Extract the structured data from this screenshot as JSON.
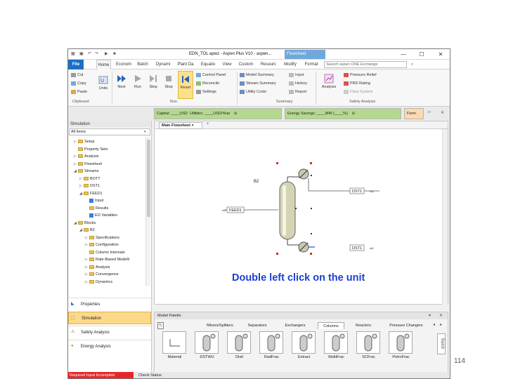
{
  "titlebar": {
    "title": "EDN_TOL apwz - Aspen Plus V10 - aspen...",
    "context_tab": "Flowsheet"
  },
  "menus": [
    "File",
    "Home",
    "Econom",
    "Batch",
    "Dynami",
    "Plant Da",
    "Equatio",
    "View",
    "Custom",
    "Resourc",
    "Modify",
    "Format"
  ],
  "search": {
    "placeholder": "Search aspen ONE Exchange"
  },
  "ribbon": {
    "clipboard": {
      "cut": "Cut",
      "copy": "Copy",
      "paste": "Paste",
      "label": "Clipboard"
    },
    "units": "Units",
    "run": {
      "next": "Next",
      "run": "Run",
      "step": "Step",
      "stop": "Stop",
      "reset": "Reset",
      "label": "Run"
    },
    "control": {
      "control_panel": "Control Panel",
      "reconcile": "Reconcile",
      "settings": "Settings"
    },
    "summary": {
      "model_summary": "Model Summary",
      "stream_summary": "Stream Summary",
      "utility_costs": "Utility Costs",
      "label": "Summary",
      "input": "Input",
      "history": "History",
      "report": "Report"
    },
    "analysis": {
      "analysis": "Analysis",
      "pressure_relief": "Pressure Relief",
      "prd_rating": "PRD Rating",
      "flare_system": "Flare System",
      "label": "Safety Analysis"
    }
  },
  "toolbar": {
    "capital": "Capital: ____USD",
    "utilities": "Utilities: ____USD/Year",
    "energy": "Energy Savings: ____MW (____%)",
    "form": "Form"
  },
  "nav": {
    "header": "Simulation",
    "filter": "All Items",
    "tree": [
      {
        "label": "Setup",
        "depth": 1,
        "arrow": "▷",
        "icon": "folder"
      },
      {
        "label": "Property Sets",
        "depth": 1,
        "arrow": "",
        "icon": "folder"
      },
      {
        "label": "Analysis",
        "depth": 1,
        "arrow": "▷",
        "icon": "folder"
      },
      {
        "label": "Flowsheet",
        "depth": 1,
        "arrow": "▷",
        "icon": "folder"
      },
      {
        "label": "Streams",
        "depth": 1,
        "arrow": "◢",
        "icon": "folder"
      },
      {
        "label": "BOTT",
        "depth": 2,
        "arrow": "▷",
        "icon": "folder"
      },
      {
        "label": "DST1",
        "depth": 2,
        "arrow": "▷",
        "icon": "folder"
      },
      {
        "label": "FEED1",
        "depth": 2,
        "arrow": "◢",
        "icon": "folder"
      },
      {
        "label": "Input",
        "depth": 3,
        "arrow": "",
        "icon": "check"
      },
      {
        "label": "Results",
        "depth": 3,
        "arrow": "",
        "icon": "folder"
      },
      {
        "label": "EO Variables",
        "depth": 3,
        "arrow": "",
        "icon": "check"
      },
      {
        "label": "Blocks",
        "depth": 1,
        "arrow": "◢",
        "icon": "folder"
      },
      {
        "label": "B2",
        "depth": 2,
        "arrow": "◢",
        "icon": "folder"
      },
      {
        "label": "Specifications",
        "depth": 3,
        "arrow": "▷",
        "icon": "folder"
      },
      {
        "label": "Configuration",
        "depth": 3,
        "arrow": "▷",
        "icon": "folder"
      },
      {
        "label": "Column Internals",
        "depth": 3,
        "arrow": "",
        "icon": "folder"
      },
      {
        "label": "Rate-Based Modelli",
        "depth": 3,
        "arrow": "▷",
        "icon": "folder"
      },
      {
        "label": "Analysis",
        "depth": 3,
        "arrow": "▷",
        "icon": "folder"
      },
      {
        "label": "Convergence",
        "depth": 3,
        "arrow": "▷",
        "icon": "folder"
      },
      {
        "label": "Dynamics",
        "depth": 3,
        "arrow": "▷",
        "icon": "folder"
      }
    ],
    "buttons": [
      "Properties",
      "Simulation",
      "Safety Analysis",
      "Energy Analysis"
    ]
  },
  "main": {
    "tab": "Main Flowsheet",
    "block_label": "B2",
    "streams": {
      "feed": "FEED1",
      "distillate": "DST1",
      "bottoms": "DST1"
    },
    "annotation": "Double left click on the unit"
  },
  "palette": {
    "header": "Model Palette",
    "categories": [
      "Mixers/Splitters",
      "Separators",
      "Exchangers",
      "Columns",
      "Reactors",
      "Pressure Changers"
    ],
    "items": [
      "Material",
      "DSTWU",
      "Distl",
      "RadFrac",
      "Extract",
      "MultiFrac",
      "SCFrac",
      "PetroFrac"
    ],
    "side": "Batch"
  },
  "status": {
    "input": "Required Input Incomplete",
    "check": "Check Status"
  },
  "page_number": "114",
  "colors": {
    "accent": "#1e6fbf",
    "annotation": "#1b3fd1",
    "status_error": "#e8262a",
    "highlight": "#fbd98a"
  }
}
